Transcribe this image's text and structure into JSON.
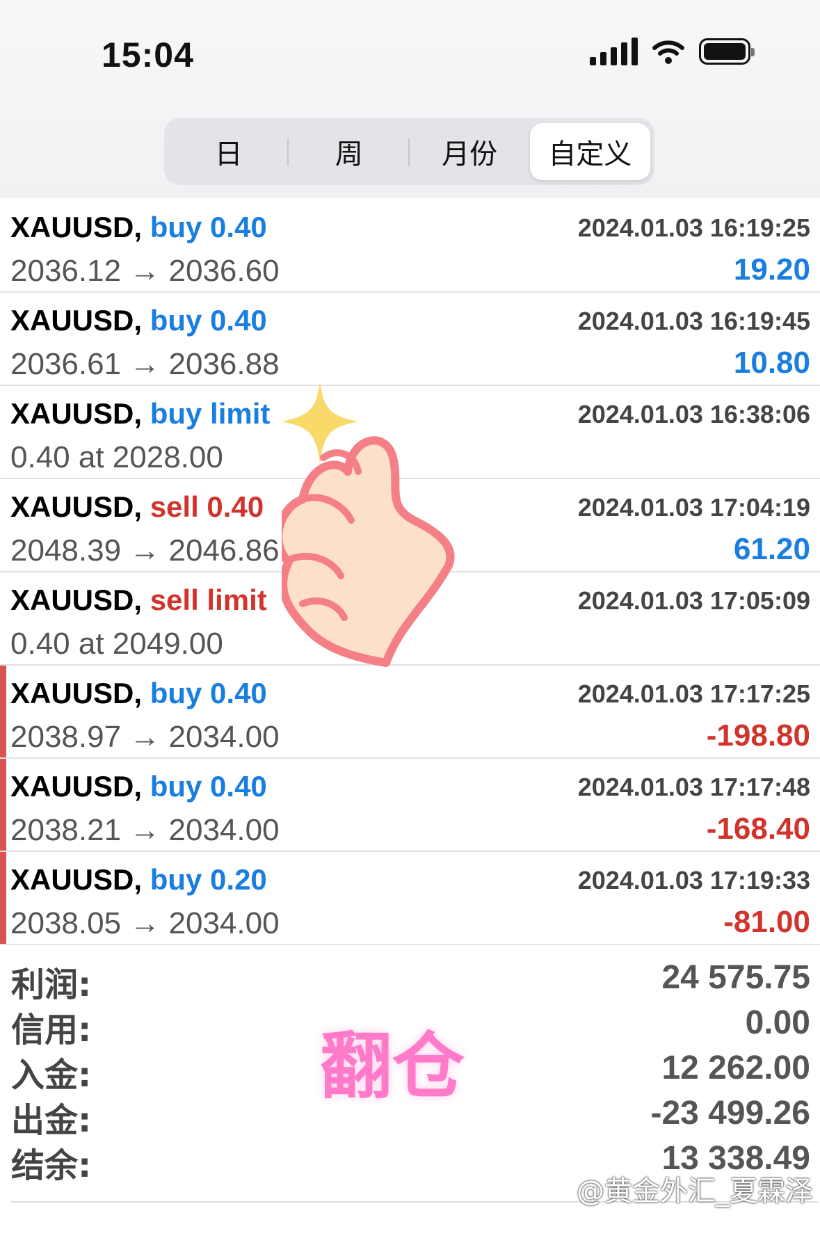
{
  "status_bar": {
    "time": "15:04",
    "icons": [
      "signal-icon",
      "wifi-icon",
      "battery-icon"
    ]
  },
  "segments": [
    "日",
    "周",
    "月份",
    "自定义"
  ],
  "selected_segment": "自定义",
  "orders": [
    {
      "symbol": "XAUUSD,",
      "side": "buy 0.40",
      "side_type": "buy",
      "time": "2024.01.03 16:19:25",
      "prices": "2036.12 → 2036.60",
      "profit": "19.20",
      "profit_type": "pos"
    },
    {
      "symbol": "XAUUSD,",
      "side": "buy 0.40",
      "side_type": "buy",
      "time": "2024.01.03 16:19:45",
      "prices": "2036.61 → 2036.88",
      "profit": "10.80",
      "profit_type": "pos"
    },
    {
      "symbol": "XAUUSD,",
      "side": "buy limit",
      "side_type": "buy",
      "time": "2024.01.03 16:38:06",
      "prices": "0.40 at 2028.00",
      "profit": "",
      "profit_type": ""
    },
    {
      "symbol": "XAUUSD,",
      "side": "sell 0.40",
      "side_type": "sell",
      "time": "2024.01.03 17:04:19",
      "prices": "2048.39 → 2046.86",
      "profit": "61.20",
      "profit_type": "pos"
    },
    {
      "symbol": "XAUUSD,",
      "side": "sell limit",
      "side_type": "sell",
      "time": "2024.01.03 17:05:09",
      "prices": "0.40 at 2049.00",
      "profit": "",
      "profit_type": ""
    },
    {
      "symbol": "XAUUSD,",
      "side": "buy 0.40",
      "side_type": "buy",
      "time": "2024.01.03 17:17:25",
      "prices": "2038.97 → 2034.00",
      "profit": "-198.80",
      "profit_type": "neg"
    },
    {
      "symbol": "XAUUSD,",
      "side": "buy 0.40",
      "side_type": "buy",
      "time": "2024.01.03 17:17:48",
      "prices": "2038.21 → 2034.00",
      "profit": "-168.40",
      "profit_type": "neg"
    },
    {
      "symbol": "XAUUSD,",
      "side": "buy 0.20",
      "side_type": "buy",
      "time": "2024.01.03 17:19:33",
      "prices": "2038.05 → 2034.00",
      "profit": "-81.00",
      "profit_type": "neg"
    }
  ],
  "summary": [
    {
      "label": "利润:",
      "value": "24 575.75"
    },
    {
      "label": "信用:",
      "value": "0.00"
    },
    {
      "label": "入金:",
      "value": "12 262.00"
    },
    {
      "label": "出金:",
      "value": "-23 499.26"
    },
    {
      "label": "结余:",
      "value": "13 338.49"
    }
  ],
  "overlay_text": "翻仓",
  "watermark": "@黄金外汇_夏霖泽",
  "colors": {
    "buy": "#1a7ee0",
    "sell": "#d0342c",
    "loss_marker": "#d9534f",
    "overlay": "#ff7ac8"
  }
}
